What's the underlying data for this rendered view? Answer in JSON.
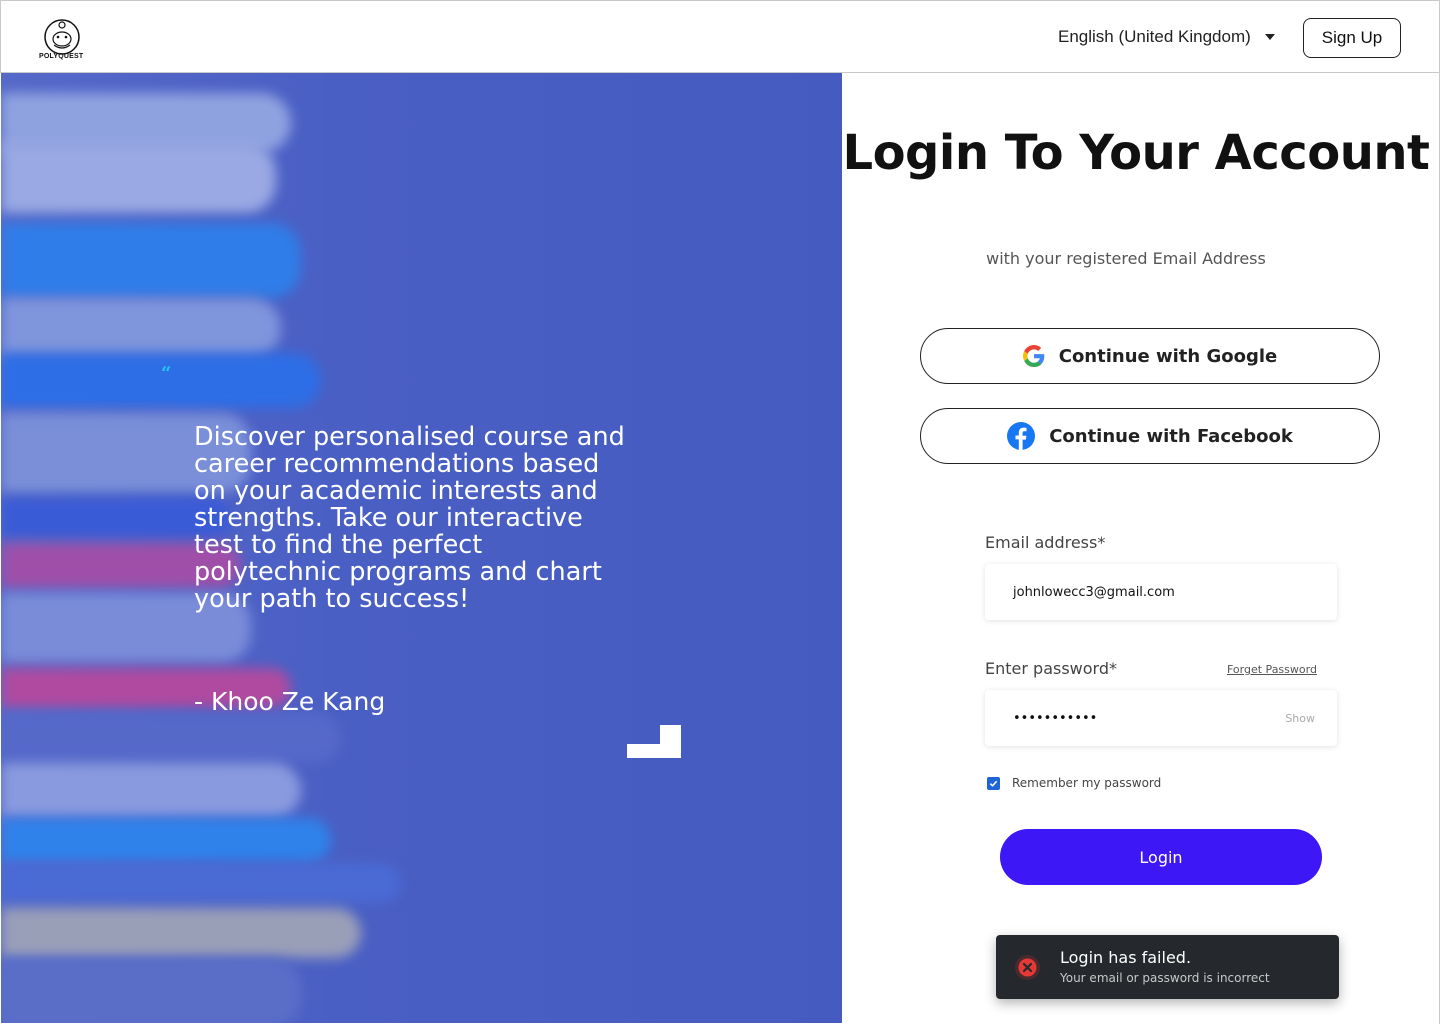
{
  "header": {
    "logo_text": "POLYQUEST",
    "language": "English (United Kingdom)",
    "signup_label": "Sign Up"
  },
  "hero": {
    "quote_mark": "“",
    "quote": "Discover personalised course and career recommendations based on your academic interests and strengths. Take our interactive test to find the perfect polytechnic programs and chart your path to success!",
    "author": "- Khoo Ze Kang"
  },
  "login": {
    "title": "Login To Your Account",
    "subtitle": "with your registered Email Address",
    "google_label": "Continue with Google",
    "facebook_label": "Continue with Facebook",
    "email_label": "Email address*",
    "email_value": "johnlowecc3@gmail.com",
    "password_label": "Enter password*",
    "forget_label": "Forget Password",
    "password_value": "•••••••••••",
    "show_label": "Show",
    "remember_label": "Remember my password",
    "remember_checked": true,
    "login_label": "Login"
  },
  "toast": {
    "title": "Login has failed.",
    "message": "Your email or password is incorrect"
  },
  "colors": {
    "accent": "#3d17f5",
    "hero_bg": "#4a5fc4",
    "toast_bg": "#25282c",
    "error": "#e53935"
  }
}
